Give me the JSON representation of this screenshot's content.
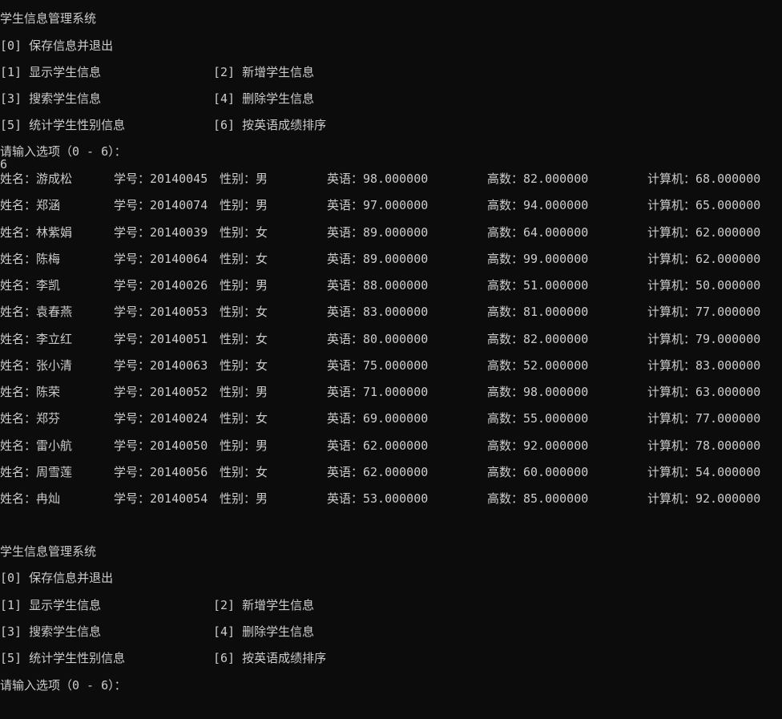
{
  "menu": {
    "title": "学生信息管理系统",
    "opt0": "[0] 保存信息并退出",
    "opt1": "[1] 显示学生信息",
    "opt2": "[2] 新增学生信息",
    "opt3": "[3] 搜索学生信息",
    "opt4": "[4] 删除学生信息",
    "opt5": "[5] 统计学生性别信息",
    "opt6": "[6] 按英语成绩排序",
    "prompt": "请输入选项（0 - 6）："
  },
  "user_input": "6",
  "records": [
    {
      "name": "姓名：游成松",
      "id": "学号：20140045",
      "sex": "性别：男",
      "eng": "英语：98.000000",
      "math": "高数：82.000000",
      "comp": "计算机：68.000000"
    },
    {
      "name": "姓名：郑涵",
      "id": "学号：20140074",
      "sex": "性别：男",
      "eng": "英语：97.000000",
      "math": "高数：94.000000",
      "comp": "计算机：65.000000"
    },
    {
      "name": "姓名：林紫娟",
      "id": "学号：20140039",
      "sex": "性别：女",
      "eng": "英语：89.000000",
      "math": "高数：64.000000",
      "comp": "计算机：62.000000"
    },
    {
      "name": "姓名：陈梅",
      "id": "学号：20140064",
      "sex": "性别：女",
      "eng": "英语：89.000000",
      "math": "高数：99.000000",
      "comp": "计算机：62.000000"
    },
    {
      "name": "姓名：李凯",
      "id": "学号：20140026",
      "sex": "性别：男",
      "eng": "英语：88.000000",
      "math": "高数：51.000000",
      "comp": "计算机：50.000000"
    },
    {
      "name": "姓名：袁春燕",
      "id": "学号：20140053",
      "sex": "性别：女",
      "eng": "英语：83.000000",
      "math": "高数：81.000000",
      "comp": "计算机：77.000000"
    },
    {
      "name": "姓名：李立红",
      "id": "学号：20140051",
      "sex": "性别：女",
      "eng": "英语：80.000000",
      "math": "高数：82.000000",
      "comp": "计算机：79.000000"
    },
    {
      "name": "姓名：张小清",
      "id": "学号：20140063",
      "sex": "性别：女",
      "eng": "英语：75.000000",
      "math": "高数：52.000000",
      "comp": "计算机：83.000000"
    },
    {
      "name": "姓名：陈荣",
      "id": "学号：20140052",
      "sex": "性别：男",
      "eng": "英语：71.000000",
      "math": "高数：98.000000",
      "comp": "计算机：63.000000"
    },
    {
      "name": "姓名：郑芬",
      "id": "学号：20140024",
      "sex": "性别：女",
      "eng": "英语：69.000000",
      "math": "高数：55.000000",
      "comp": "计算机：77.000000"
    },
    {
      "name": "姓名：雷小航",
      "id": "学号：20140050",
      "sex": "性别：男",
      "eng": "英语：62.000000",
      "math": "高数：92.000000",
      "comp": "计算机：78.000000"
    },
    {
      "name": "姓名：周雪莲",
      "id": "学号：20140056",
      "sex": "性别：女",
      "eng": "英语：62.000000",
      "math": "高数：60.000000",
      "comp": "计算机：54.000000"
    },
    {
      "name": "姓名：冉灿",
      "id": "学号：20140054",
      "sex": "性别：男",
      "eng": "英语：53.000000",
      "math": "高数：85.000000",
      "comp": "计算机：92.000000"
    }
  ],
  "colors": {
    "background": "#0c0c0c",
    "text": "#cccccc"
  }
}
